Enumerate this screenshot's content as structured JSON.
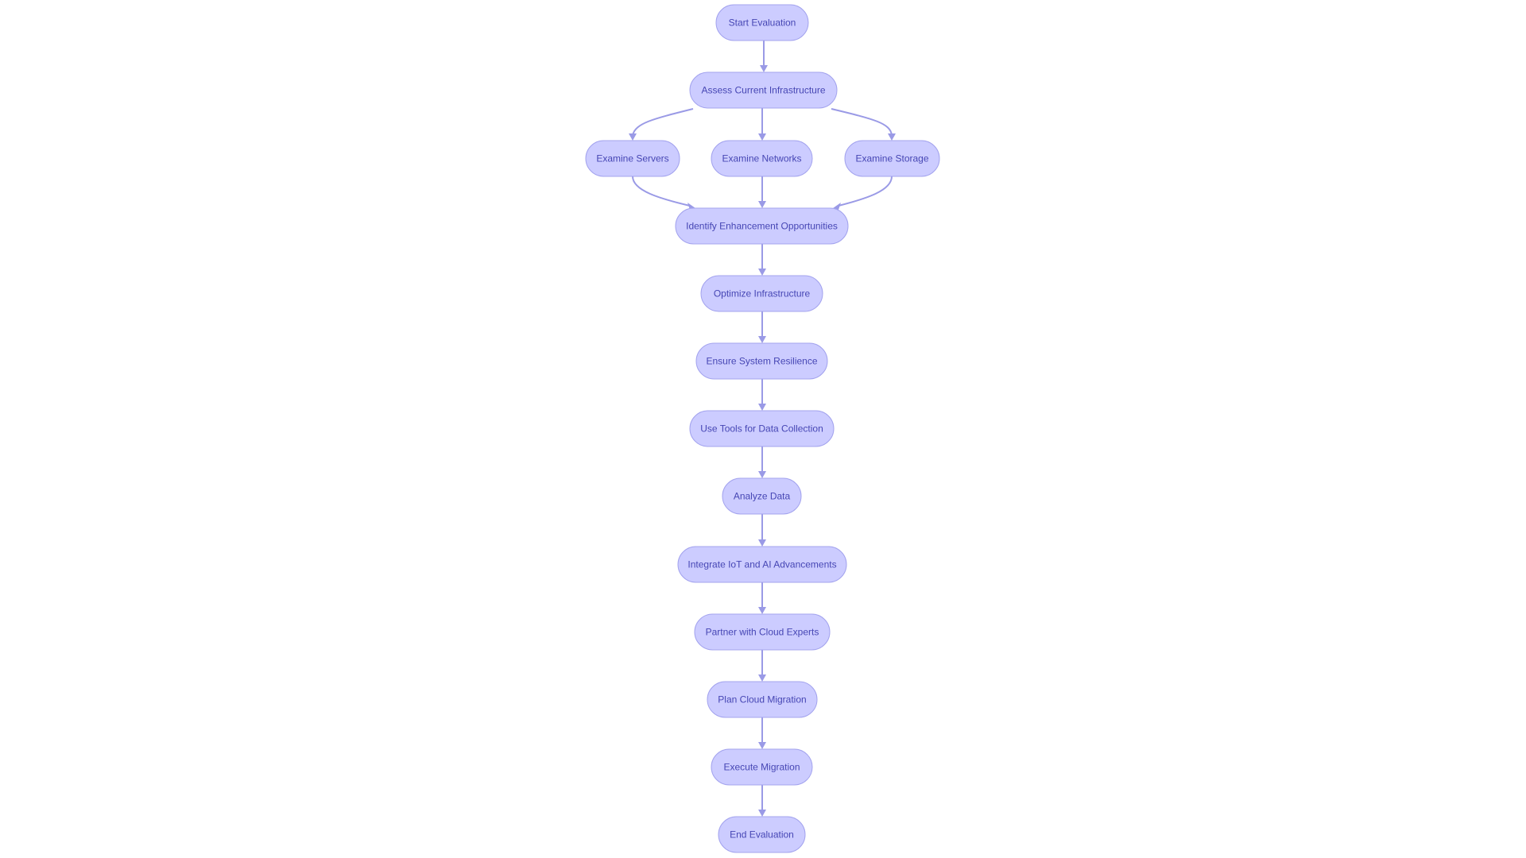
{
  "diagram": {
    "type": "flowchart",
    "direction": "top-down",
    "colors": {
      "node_fill": "#CCCCFF",
      "node_stroke": "#A3A3EE",
      "edge": "#9A9AE6",
      "text": "#4646B4",
      "background": "#FFFFFF"
    },
    "nodes": [
      {
        "id": "start",
        "label": "Start Evaluation"
      },
      {
        "id": "assess",
        "label": "Assess Current Infrastructure"
      },
      {
        "id": "servers",
        "label": "Examine Servers"
      },
      {
        "id": "networks",
        "label": "Examine Networks"
      },
      {
        "id": "storage",
        "label": "Examine Storage"
      },
      {
        "id": "identify",
        "label": "Identify Enhancement Opportunities"
      },
      {
        "id": "optimize",
        "label": "Optimize Infrastructure"
      },
      {
        "id": "resilience",
        "label": "Ensure System Resilience"
      },
      {
        "id": "tools",
        "label": "Use Tools for Data Collection"
      },
      {
        "id": "analyze",
        "label": "Analyze Data"
      },
      {
        "id": "integrate",
        "label": "Integrate IoT and AI Advancements"
      },
      {
        "id": "partner",
        "label": "Partner with Cloud Experts"
      },
      {
        "id": "plan",
        "label": "Plan Cloud Migration"
      },
      {
        "id": "execute",
        "label": "Execute Migration"
      },
      {
        "id": "end",
        "label": "End Evaluation"
      }
    ],
    "edges": [
      {
        "from": "start",
        "to": "assess"
      },
      {
        "from": "assess",
        "to": "servers"
      },
      {
        "from": "assess",
        "to": "networks"
      },
      {
        "from": "assess",
        "to": "storage"
      },
      {
        "from": "servers",
        "to": "identify"
      },
      {
        "from": "networks",
        "to": "identify"
      },
      {
        "from": "storage",
        "to": "identify"
      },
      {
        "from": "identify",
        "to": "optimize"
      },
      {
        "from": "optimize",
        "to": "resilience"
      },
      {
        "from": "resilience",
        "to": "tools"
      },
      {
        "from": "tools",
        "to": "analyze"
      },
      {
        "from": "analyze",
        "to": "integrate"
      },
      {
        "from": "integrate",
        "to": "partner"
      },
      {
        "from": "partner",
        "to": "plan"
      },
      {
        "from": "plan",
        "to": "execute"
      },
      {
        "from": "execute",
        "to": "end"
      }
    ]
  }
}
